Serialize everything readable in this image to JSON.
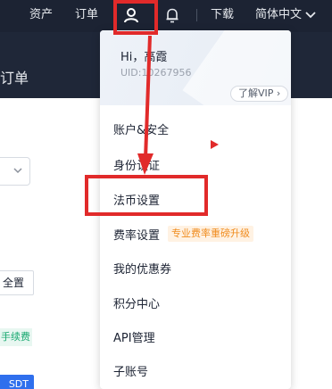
{
  "topbar": {
    "assets": "资产",
    "orders": "订单",
    "download": "下载",
    "language": "简体中文"
  },
  "background": {
    "header_title": "币订单",
    "input_text": "全置",
    "tag_text": "手续费",
    "button_text": "SDT"
  },
  "user_menu": {
    "greeting": "Hi，高霞",
    "uid": "UID:10267956",
    "vip_link": "了解VIP",
    "items": [
      {
        "label": "账户&安全"
      },
      {
        "label": "身份认证"
      },
      {
        "label": "法币设置"
      },
      {
        "label": "费率设置",
        "badge": "专业费率重磅升级"
      },
      {
        "label": "我的优惠券"
      },
      {
        "label": "积分中心"
      },
      {
        "label": "API管理"
      },
      {
        "label": "子账号"
      }
    ]
  },
  "colors": {
    "topbar_bg": "#1c2333",
    "annotation": "#e12a2a",
    "badge_fg": "#f08c1e",
    "primary": "#2f6fed"
  }
}
